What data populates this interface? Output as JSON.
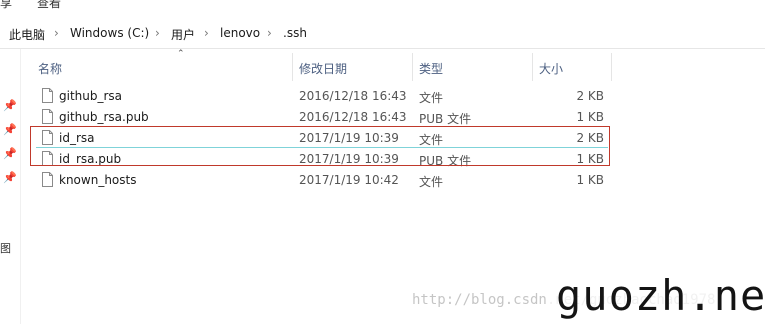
{
  "ribbon": {
    "tabs": [
      "享",
      "查看"
    ]
  },
  "address": {
    "crumbs": [
      "此电脑",
      "Windows (C:)",
      "用户",
      "lenovo",
      ".ssh"
    ]
  },
  "columns": {
    "name": "名称",
    "date": "修改日期",
    "type": "类型",
    "size": "大小"
  },
  "files": [
    {
      "name": "github_rsa",
      "date": "2016/12/18 16:43",
      "type": "文件",
      "size": "2 KB"
    },
    {
      "name": "github_rsa.pub",
      "date": "2016/12/18 16:43",
      "type": "PUB 文件",
      "size": "1 KB"
    },
    {
      "name": "id_rsa",
      "date": "2017/1/19 10:39",
      "type": "文件",
      "size": "2 KB"
    },
    {
      "name": "id_rsa.pub",
      "date": "2017/1/19 10:39",
      "type": "PUB 文件",
      "size": "1 KB"
    },
    {
      "name": "known_hosts",
      "date": "2017/1/19 10:42",
      "type": "文件",
      "size": "1 KB"
    }
  ],
  "nav": {
    "label": "图"
  },
  "watermark": {
    "url": "http://blog.csdn.net/guozhaochao1978",
    "logo": "guozh.net"
  },
  "colors": {
    "highlight_border": "#c0392b",
    "header_text": "#4d6082",
    "selection_line": "#7fd3d9"
  }
}
